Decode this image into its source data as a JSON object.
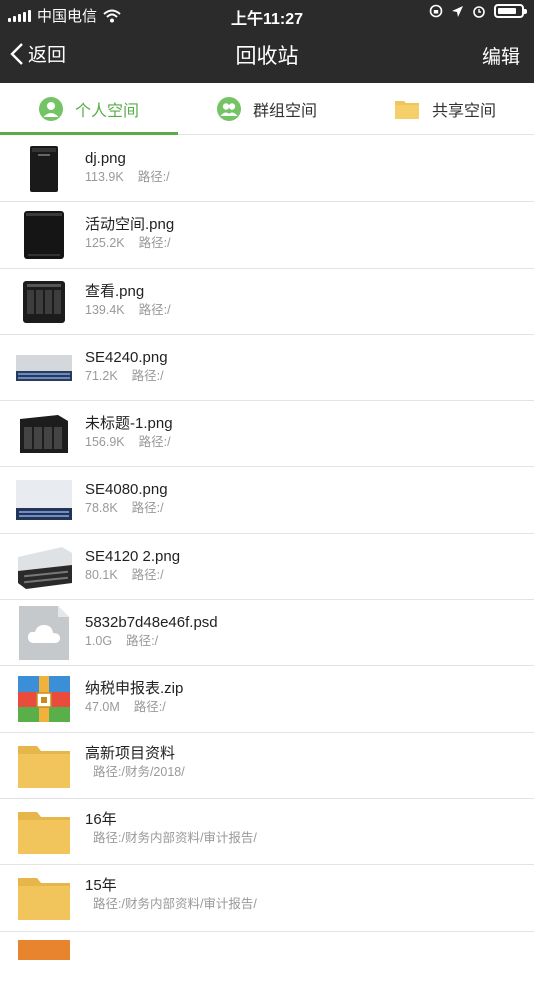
{
  "status": {
    "carrier": "中国电信",
    "time": "上午11:27"
  },
  "nav": {
    "back_label": "返回",
    "title": "回收站",
    "edit_label": "编辑"
  },
  "tabs": [
    {
      "label": "个人空间",
      "icon": "person-icon",
      "active": true
    },
    {
      "label": "群组空间",
      "icon": "group-icon",
      "active": false
    },
    {
      "label": "共享空间",
      "icon": "folder-icon",
      "active": false
    }
  ],
  "files": [
    {
      "name": "dj.png",
      "size": "113.9K",
      "path": "路径:/",
      "thumb": "tower-server"
    },
    {
      "name": "活动空间.png",
      "size": "125.2K",
      "path": "路径:/",
      "thumb": "nas-box"
    },
    {
      "name": "查看.png",
      "size": "139.4K",
      "path": "路径:/",
      "thumb": "nas-4bay"
    },
    {
      "name": "SE4240.png",
      "size": "71.2K",
      "path": "路径:/",
      "thumb": "rack-server"
    },
    {
      "name": "未标题-1.png",
      "size": "156.9K",
      "path": "路径:/",
      "thumb": "nas-4bay"
    },
    {
      "name": "SE4080.png",
      "size": "78.8K",
      "path": "路径:/",
      "thumb": "rack-server-white"
    },
    {
      "name": "SE4120 2.png",
      "size": "80.1K",
      "path": "路径:/",
      "thumb": "rack-server-angle"
    },
    {
      "name": "5832b7d48e46f.psd",
      "size": "1.0G",
      "path": "路径:/",
      "thumb": "cloud-file"
    },
    {
      "name": "纳税申报表.zip",
      "size": "47.0M",
      "path": "路径:/",
      "thumb": "zip-file"
    },
    {
      "name": "高新项目资料",
      "size": "",
      "path": "路径:/财务/2018/",
      "thumb": "folder"
    },
    {
      "name": "16年",
      "size": "",
      "path": "路径:/财务内部资料/审计报告/",
      "thumb": "folder"
    },
    {
      "name": "15年",
      "size": "",
      "path": "路径:/财务内部资料/审计报告/",
      "thumb": "folder"
    }
  ],
  "colors": {
    "accent": "#5aac4b",
    "topbar": "#2b2b2b",
    "folder": "#f2c55c"
  }
}
